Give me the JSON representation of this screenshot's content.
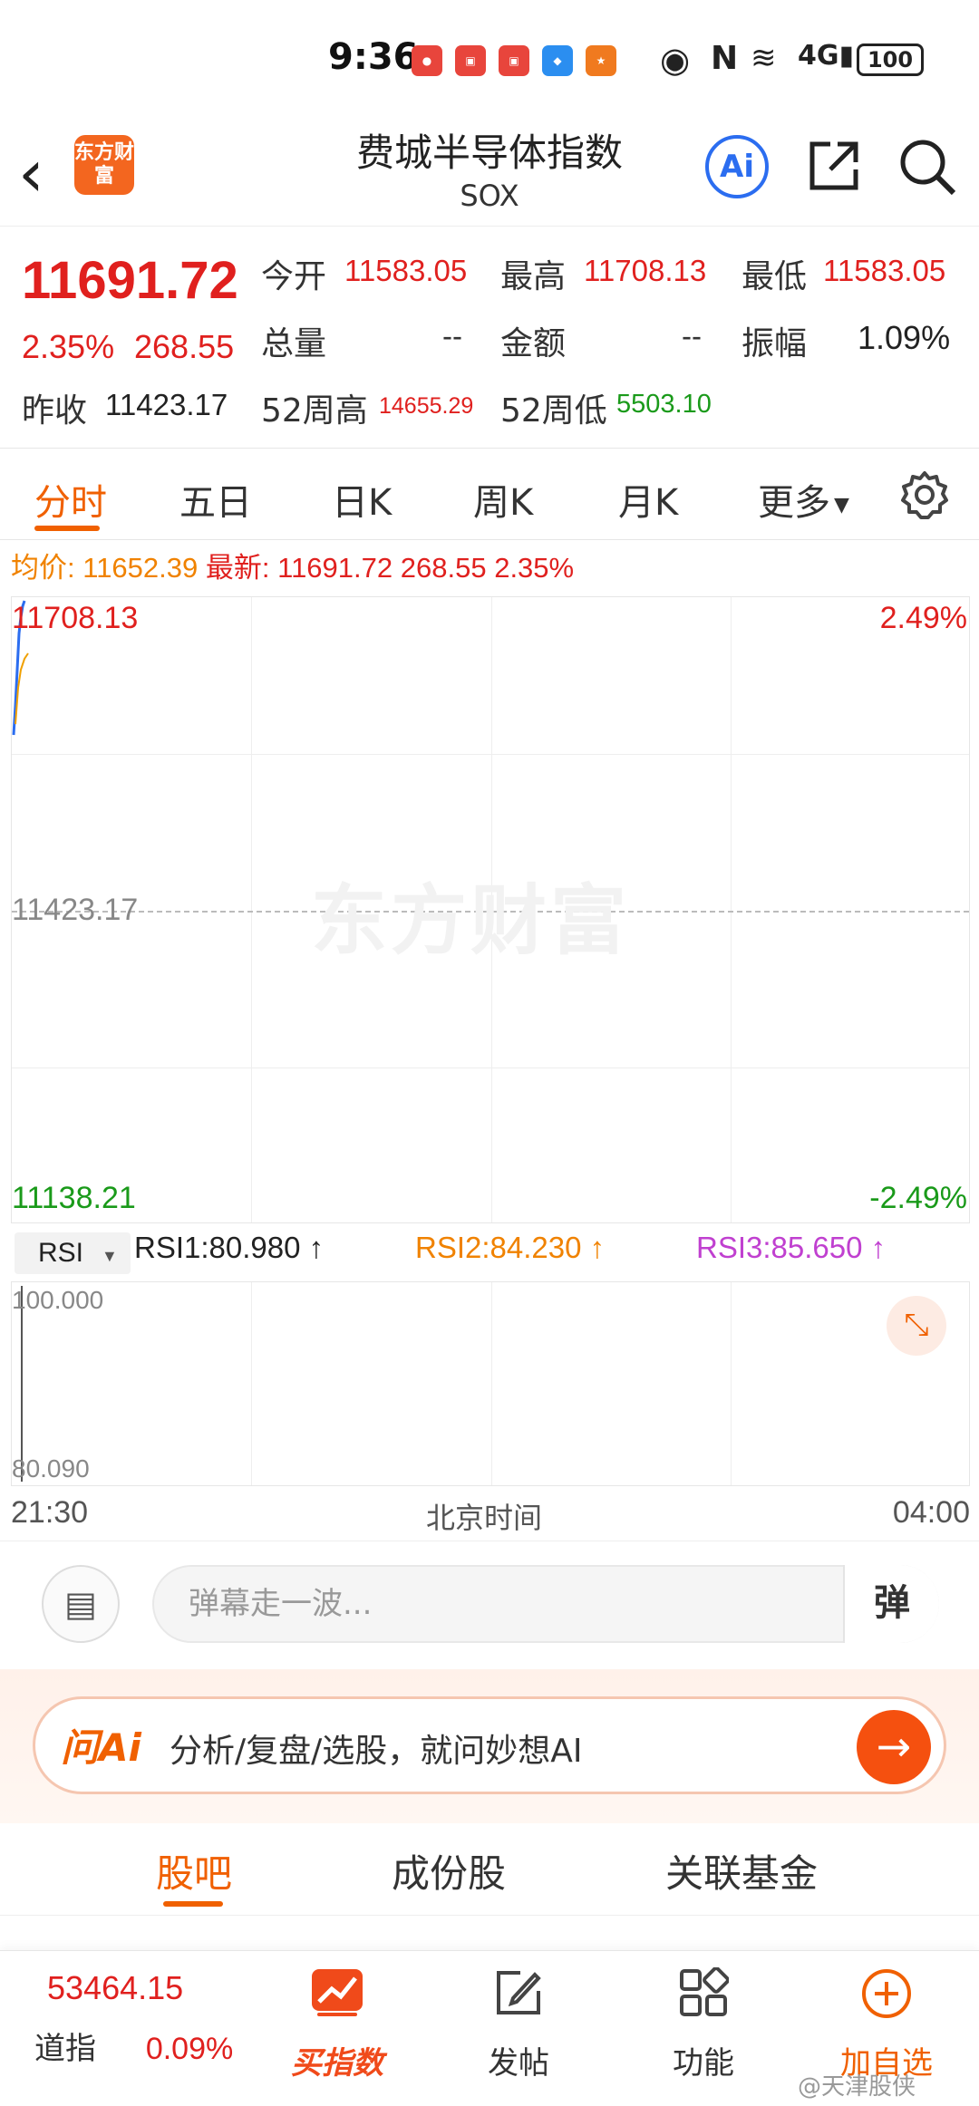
{
  "status_bar": {
    "time": "9:36",
    "battery": "100"
  },
  "header": {
    "title": "费城半导体指数",
    "subtitle": "SOX",
    "logo_text": "东方财富",
    "ai_label": "Ai"
  },
  "quote": {
    "price": "11691.72",
    "change_pct": "2.35%",
    "change": "268.55",
    "open_label": "今开",
    "open": "11583.05",
    "high_label": "最高",
    "high": "11708.13",
    "low_label": "最低",
    "low": "11583.05",
    "volume_label": "总量",
    "volume": "--",
    "amount_label": "金额",
    "amount": "--",
    "amplitude_label": "振幅",
    "amplitude": "1.09%",
    "prev_close_label": "昨收",
    "prev_close": "11423.17",
    "w52_high_label": "52周高",
    "w52_high": "14655.29",
    "w52_low_label": "52周低",
    "w52_low": "5503.10"
  },
  "chart_tabs": [
    "分时",
    "五日",
    "日K",
    "周K",
    "月K",
    "更多"
  ],
  "info_line": {
    "avg_label": "均价:",
    "avg_value": "11652.39",
    "latest_label": "最新:",
    "latest_value": "11691.72",
    "latest_change": "268.55",
    "latest_pct": "2.35%"
  },
  "main_chart": {
    "top_price": "11708.13",
    "mid_price": "11423.17",
    "bottom_price": "11138.21",
    "top_pct": "2.49%",
    "bottom_pct": "-2.49%",
    "watermark": "东方财富"
  },
  "rsi": {
    "selector": "RSI",
    "rsi1": "RSI1:80.980",
    "rsi2": "RSI2:84.230",
    "rsi3": "RSI3:85.650",
    "top": "100.000",
    "bottom": "80.090"
  },
  "time_axis": {
    "start": "21:30",
    "middle": "北京时间",
    "end": "04:00"
  },
  "danmu": {
    "placeholder": "弹幕走一波...",
    "send_label": "弹"
  },
  "ai_banner": {
    "brand": "问Ai",
    "prompt": "分析/复盘/选股，就问妙想AI"
  },
  "community_tabs": [
    "股吧",
    "成份股",
    "关联基金"
  ],
  "bottom_nav": {
    "ticker_value": "53464.15",
    "ticker_name": "道指",
    "ticker_pct": "0.09%",
    "buy_index": "买指数",
    "post": "发帖",
    "functions": "功能",
    "add_watch": "加自选"
  },
  "watermark_credit": "@天津股侠",
  "colors": {
    "accent": "#f06000",
    "up": "#e0201e",
    "down": "#1a9a1a",
    "price_line": "#2b6df0",
    "avg_line": "#f0a000",
    "rsi2": "#f0a000",
    "rsi3": "#c040d0"
  }
}
